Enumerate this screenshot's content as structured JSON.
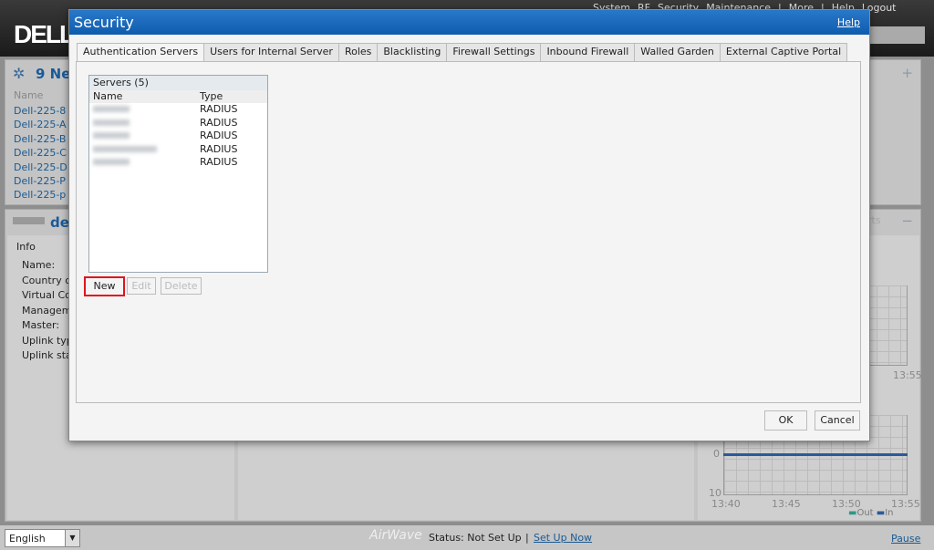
{
  "header": {
    "logo": "DELL",
    "nav": [
      "System",
      "RF",
      "Security",
      "Maintenance",
      "|",
      "More",
      "|",
      "Help",
      "Logout"
    ]
  },
  "background": {
    "networks_title": "9 Ne",
    "name_col": "Name",
    "devices": [
      "Dell-225-8",
      "Dell-225-A",
      "Dell-225-B",
      "Dell-225-C",
      "Dell-225-D",
      "Dell-225-P",
      "Dell-225-p"
    ],
    "device_title": "de",
    "info_label": "Info",
    "info_fields": [
      "Name:",
      "Country c",
      "Virtual Co",
      "Managem",
      "Master:",
      "Uplink typ",
      "Uplink sta"
    ],
    "reports_partial": "rts",
    "chart_top_tick": "13:55",
    "chart_ticks_y": [
      "0",
      "10"
    ],
    "chart_ticks_x": [
      "13:40",
      "13:45",
      "13:50",
      "13:55"
    ],
    "legend": [
      "Out",
      "In"
    ],
    "legend_colors": [
      "#2a9a8a",
      "#2a5a9a"
    ]
  },
  "dialog": {
    "title": "Security",
    "help": "Help",
    "tabs": [
      "Authentication Servers",
      "Users for Internal Server",
      "Roles",
      "Blacklisting",
      "Firewall Settings",
      "Inbound Firewall",
      "Walled Garden",
      "External Captive Portal"
    ],
    "servers": {
      "caption": "Servers (5)",
      "columns": [
        "Name",
        "Type"
      ],
      "rows": [
        {
          "type": "RADIUS"
        },
        {
          "type": "RADIUS"
        },
        {
          "type": "RADIUS"
        },
        {
          "type": "RADIUS"
        },
        {
          "type": "RADIUS"
        }
      ]
    },
    "buttons": {
      "new": "New",
      "edit": "Edit",
      "delete": "Delete",
      "ok": "OK",
      "cancel": "Cancel"
    },
    "highlight_color": "#e0141e"
  },
  "footer": {
    "language": "English",
    "brand": "AirWave",
    "status": "Status: Not Set Up",
    "sep": "|",
    "setup": "Set Up Now",
    "pause": "Pause"
  }
}
